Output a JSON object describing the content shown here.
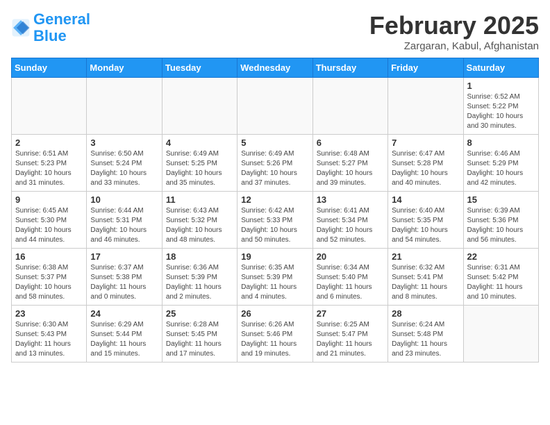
{
  "logo": {
    "text_general": "General",
    "text_blue": "Blue"
  },
  "title": "February 2025",
  "location": "Zargaran, Kabul, Afghanistan",
  "weekdays": [
    "Sunday",
    "Monday",
    "Tuesday",
    "Wednesday",
    "Thursday",
    "Friday",
    "Saturday"
  ],
  "weeks": [
    [
      {
        "day": "",
        "info": ""
      },
      {
        "day": "",
        "info": ""
      },
      {
        "day": "",
        "info": ""
      },
      {
        "day": "",
        "info": ""
      },
      {
        "day": "",
        "info": ""
      },
      {
        "day": "",
        "info": ""
      },
      {
        "day": "1",
        "info": "Sunrise: 6:52 AM\nSunset: 5:22 PM\nDaylight: 10 hours and 30 minutes."
      }
    ],
    [
      {
        "day": "2",
        "info": "Sunrise: 6:51 AM\nSunset: 5:23 PM\nDaylight: 10 hours and 31 minutes."
      },
      {
        "day": "3",
        "info": "Sunrise: 6:50 AM\nSunset: 5:24 PM\nDaylight: 10 hours and 33 minutes."
      },
      {
        "day": "4",
        "info": "Sunrise: 6:49 AM\nSunset: 5:25 PM\nDaylight: 10 hours and 35 minutes."
      },
      {
        "day": "5",
        "info": "Sunrise: 6:49 AM\nSunset: 5:26 PM\nDaylight: 10 hours and 37 minutes."
      },
      {
        "day": "6",
        "info": "Sunrise: 6:48 AM\nSunset: 5:27 PM\nDaylight: 10 hours and 39 minutes."
      },
      {
        "day": "7",
        "info": "Sunrise: 6:47 AM\nSunset: 5:28 PM\nDaylight: 10 hours and 40 minutes."
      },
      {
        "day": "8",
        "info": "Sunrise: 6:46 AM\nSunset: 5:29 PM\nDaylight: 10 hours and 42 minutes."
      }
    ],
    [
      {
        "day": "9",
        "info": "Sunrise: 6:45 AM\nSunset: 5:30 PM\nDaylight: 10 hours and 44 minutes."
      },
      {
        "day": "10",
        "info": "Sunrise: 6:44 AM\nSunset: 5:31 PM\nDaylight: 10 hours and 46 minutes."
      },
      {
        "day": "11",
        "info": "Sunrise: 6:43 AM\nSunset: 5:32 PM\nDaylight: 10 hours and 48 minutes."
      },
      {
        "day": "12",
        "info": "Sunrise: 6:42 AM\nSunset: 5:33 PM\nDaylight: 10 hours and 50 minutes."
      },
      {
        "day": "13",
        "info": "Sunrise: 6:41 AM\nSunset: 5:34 PM\nDaylight: 10 hours and 52 minutes."
      },
      {
        "day": "14",
        "info": "Sunrise: 6:40 AM\nSunset: 5:35 PM\nDaylight: 10 hours and 54 minutes."
      },
      {
        "day": "15",
        "info": "Sunrise: 6:39 AM\nSunset: 5:36 PM\nDaylight: 10 hours and 56 minutes."
      }
    ],
    [
      {
        "day": "16",
        "info": "Sunrise: 6:38 AM\nSunset: 5:37 PM\nDaylight: 10 hours and 58 minutes."
      },
      {
        "day": "17",
        "info": "Sunrise: 6:37 AM\nSunset: 5:38 PM\nDaylight: 11 hours and 0 minutes."
      },
      {
        "day": "18",
        "info": "Sunrise: 6:36 AM\nSunset: 5:39 PM\nDaylight: 11 hours and 2 minutes."
      },
      {
        "day": "19",
        "info": "Sunrise: 6:35 AM\nSunset: 5:39 PM\nDaylight: 11 hours and 4 minutes."
      },
      {
        "day": "20",
        "info": "Sunrise: 6:34 AM\nSunset: 5:40 PM\nDaylight: 11 hours and 6 minutes."
      },
      {
        "day": "21",
        "info": "Sunrise: 6:32 AM\nSunset: 5:41 PM\nDaylight: 11 hours and 8 minutes."
      },
      {
        "day": "22",
        "info": "Sunrise: 6:31 AM\nSunset: 5:42 PM\nDaylight: 11 hours and 10 minutes."
      }
    ],
    [
      {
        "day": "23",
        "info": "Sunrise: 6:30 AM\nSunset: 5:43 PM\nDaylight: 11 hours and 13 minutes."
      },
      {
        "day": "24",
        "info": "Sunrise: 6:29 AM\nSunset: 5:44 PM\nDaylight: 11 hours and 15 minutes."
      },
      {
        "day": "25",
        "info": "Sunrise: 6:28 AM\nSunset: 5:45 PM\nDaylight: 11 hours and 17 minutes."
      },
      {
        "day": "26",
        "info": "Sunrise: 6:26 AM\nSunset: 5:46 PM\nDaylight: 11 hours and 19 minutes."
      },
      {
        "day": "27",
        "info": "Sunrise: 6:25 AM\nSunset: 5:47 PM\nDaylight: 11 hours and 21 minutes."
      },
      {
        "day": "28",
        "info": "Sunrise: 6:24 AM\nSunset: 5:48 PM\nDaylight: 11 hours and 23 minutes."
      },
      {
        "day": "",
        "info": ""
      }
    ]
  ]
}
